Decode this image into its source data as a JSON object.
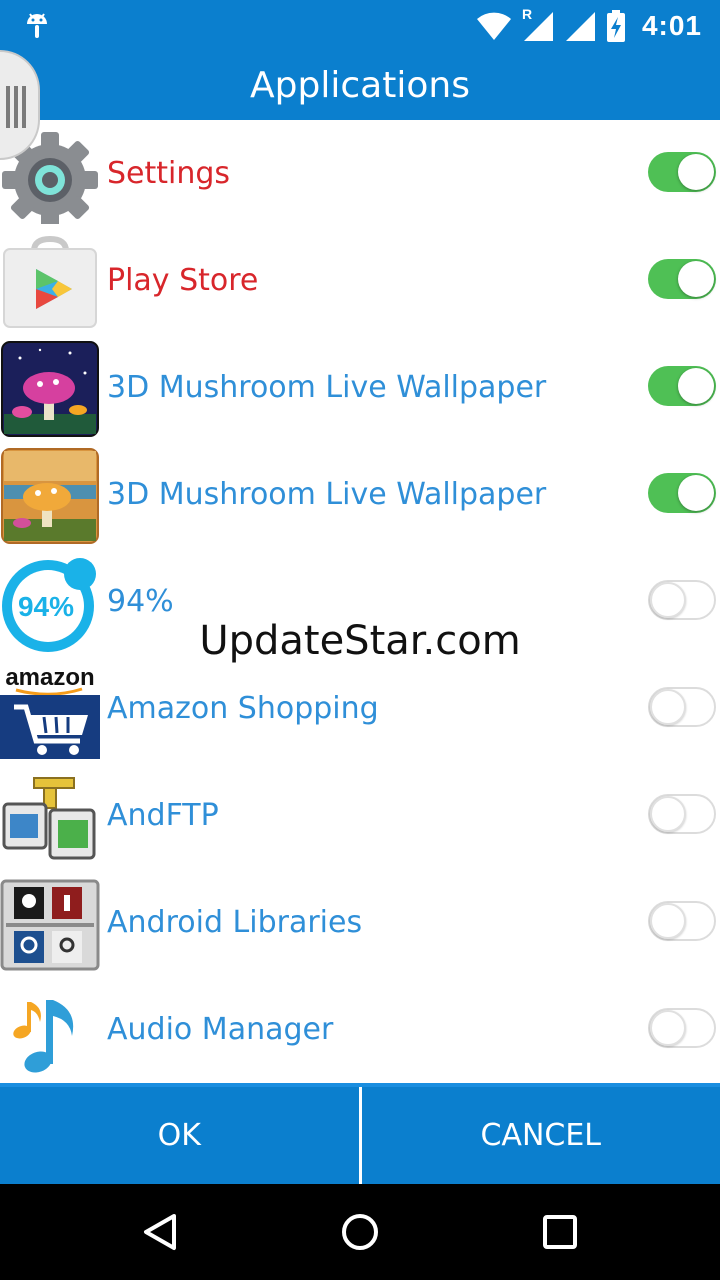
{
  "status": {
    "time": "4:01",
    "network_badge": "R"
  },
  "header": {
    "title": "Applications"
  },
  "apps": [
    {
      "label": "Settings",
      "icon": "gear-icon",
      "enabled": true,
      "color": "#d8262b"
    },
    {
      "label": "Play Store",
      "icon": "play-store-icon",
      "enabled": true,
      "color": "#d8262b"
    },
    {
      "label": "3D Mushroom Live Wallpaper",
      "icon": "mushroom-night-icon",
      "enabled": true
    },
    {
      "label": "3D Mushroom Live Wallpaper",
      "icon": "mushroom-sunset-icon",
      "enabled": true
    },
    {
      "label": "94%",
      "icon": "94-percent-icon",
      "icon_text": "94%",
      "enabled": false
    },
    {
      "label": "Amazon Shopping",
      "icon": "amazon-cart-icon",
      "icon_text": "amazon",
      "enabled": false
    },
    {
      "label": "AndFTP",
      "icon": "andftp-icon",
      "enabled": false
    },
    {
      "label": "Android Libraries",
      "icon": "android-libraries-icon",
      "enabled": false
    },
    {
      "label": "Audio Manager",
      "icon": "music-note-icon",
      "enabled": false
    }
  ],
  "watermark": "UpdateStar.com",
  "buttons": {
    "ok": "OK",
    "cancel": "CANCEL"
  },
  "colors": {
    "primary": "#0b7fce",
    "toggle_on": "#4fc055",
    "label_blue": "#2f8fd8",
    "label_red": "#d8262b"
  }
}
